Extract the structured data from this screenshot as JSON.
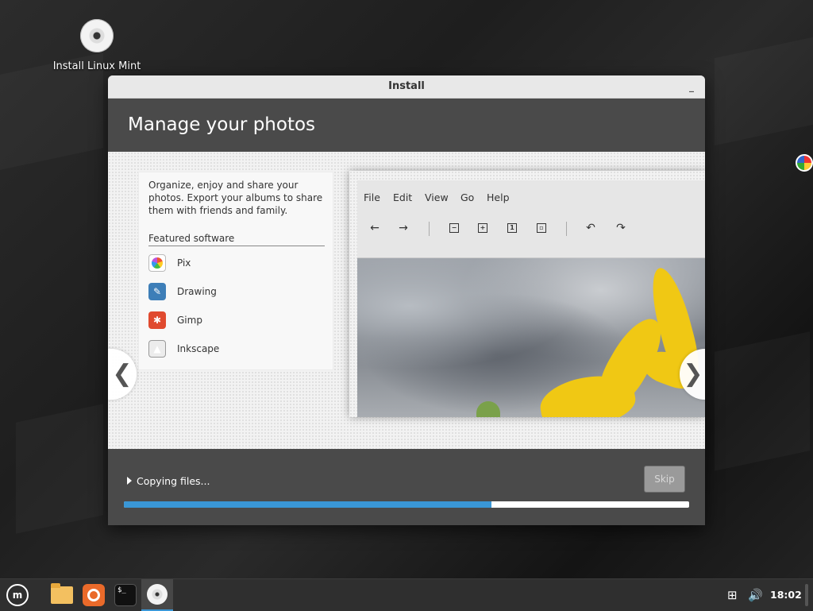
{
  "desktop": {
    "icon_label": "Install Linux Mint"
  },
  "window": {
    "title": "Install",
    "minimize_label": "_",
    "header_title": "Manage your photos"
  },
  "slide": {
    "description": "Organize, enjoy and share your photos. Export your albums to share them with friends and family.",
    "featured_title": "Featured software",
    "apps": [
      {
        "name": "Pix",
        "icon": "pix-icon"
      },
      {
        "name": "Drawing",
        "icon": "drawing-icon"
      },
      {
        "name": "Gimp",
        "icon": "gimp-icon"
      },
      {
        "name": "Inkscape",
        "icon": "inkscape-icon"
      }
    ],
    "screenshot_menu": [
      "File",
      "Edit",
      "View",
      "Go",
      "Help"
    ],
    "nav_prev": "❮",
    "nav_next": "❯"
  },
  "footer": {
    "status": "Copying files...",
    "skip_label": "Skip",
    "progress": 0.65,
    "progress_color": "#3a97d6"
  },
  "taskbar": {
    "terminal_glyph": "$_",
    "clock": "18:02"
  }
}
